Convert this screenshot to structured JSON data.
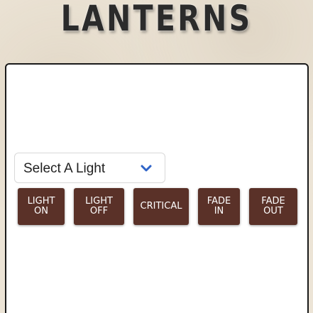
{
  "app": {
    "title": "LANTERNS"
  },
  "light_select": {
    "selected": "Select A Light"
  },
  "controls": {
    "light_on": [
      "LIGHT",
      "ON"
    ],
    "light_off": [
      "LIGHT",
      "OFF"
    ],
    "critical": "CRITICAL",
    "fade_in": [
      "FADE",
      "IN"
    ],
    "fade_out": [
      "FADE",
      "OUT"
    ]
  },
  "colors": {
    "button_bg": "#5a3128",
    "chevron": "#2f64c8",
    "background": "#ece4d6"
  },
  "icons": {
    "select_arrow": "chevron-down-icon"
  }
}
